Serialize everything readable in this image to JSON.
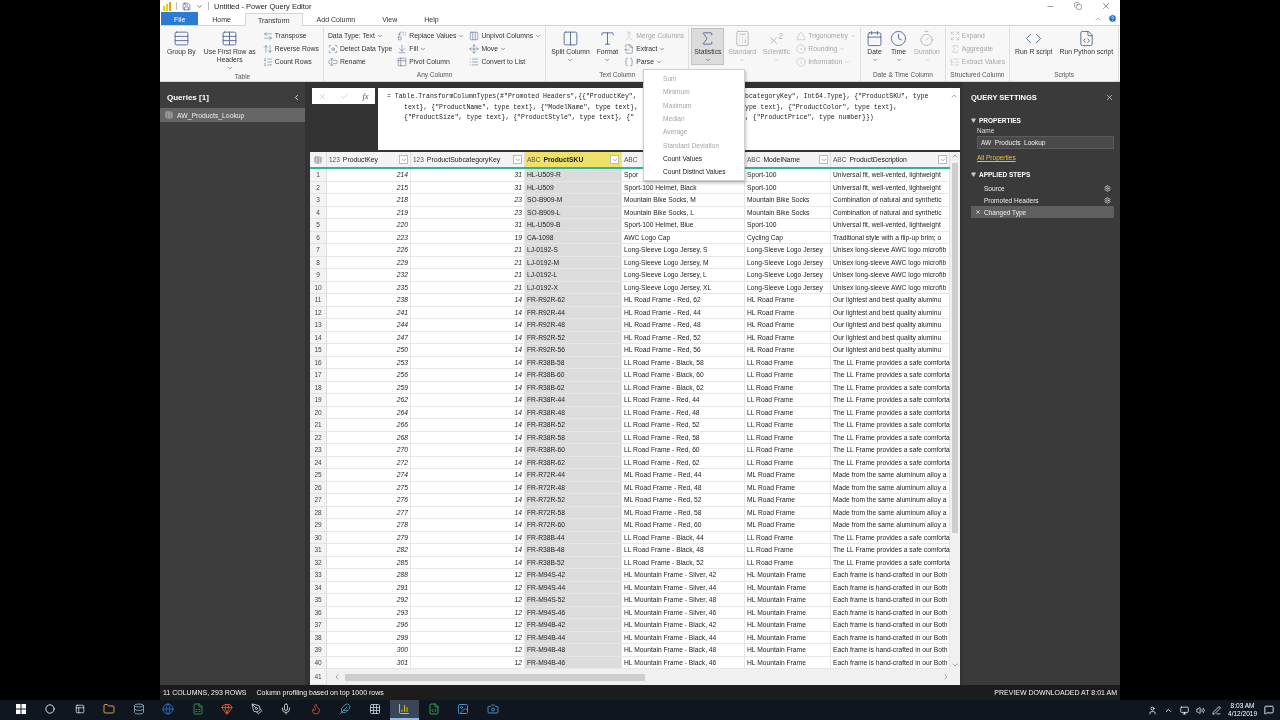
{
  "window": {
    "title": "Untitled - Power Query Editor"
  },
  "tabs": [
    {
      "label": "File",
      "kind": "file",
      "selected": false
    },
    {
      "label": "Home",
      "kind": "tab",
      "selected": false
    },
    {
      "label": "Transform",
      "kind": "tab",
      "selected": true
    },
    {
      "label": "Add Column",
      "kind": "tab",
      "selected": false
    },
    {
      "label": "View",
      "kind": "tab",
      "selected": false
    },
    {
      "label": "Help",
      "kind": "tab",
      "selected": false
    }
  ],
  "ribbon": [
    {
      "label": "Table",
      "columns": [
        {
          "kind": "large",
          "label": "Group By",
          "caret": false,
          "disabled": false,
          "pressed": false
        },
        {
          "kind": "large",
          "label": "Use First Row as Headers",
          "caret": true,
          "disabled": false,
          "pressed": false
        },
        {
          "kind": "stack",
          "items": [
            {
              "label": "Transpose",
              "caret": false,
              "disabled": false
            },
            {
              "label": "Reverse Rows",
              "caret": false,
              "disabled": false
            },
            {
              "label": "Count Rows",
              "caret": false,
              "disabled": false
            }
          ]
        }
      ]
    },
    {
      "label": "Any Column",
      "columns": [
        {
          "kind": "stack",
          "items": [
            {
              "label": "Data Type: Text",
              "caret": true,
              "disabled": false
            },
            {
              "label": "Detect Data Type",
              "caret": false,
              "disabled": false
            },
            {
              "label": "Rename",
              "caret": false,
              "disabled": false
            }
          ]
        },
        {
          "kind": "stack",
          "items": [
            {
              "label": "Replace Values",
              "caret": true,
              "disabled": false
            },
            {
              "label": "Fill",
              "caret": true,
              "disabled": false
            },
            {
              "label": "Pivot Column",
              "caret": false,
              "disabled": false
            }
          ]
        },
        {
          "kind": "stack",
          "items": [
            {
              "label": "Unpivot Columns",
              "caret": true,
              "disabled": false
            },
            {
              "label": "Move",
              "caret": true,
              "disabled": false
            },
            {
              "label": "Convert to List",
              "caret": false,
              "disabled": false
            }
          ]
        }
      ]
    },
    {
      "label": "Text Column",
      "columns": [
        {
          "kind": "large",
          "label": "Split Column",
          "caret": true,
          "disabled": false,
          "pressed": false
        },
        {
          "kind": "large",
          "label": "Format",
          "caret": true,
          "disabled": false,
          "pressed": false
        },
        {
          "kind": "stack",
          "items": [
            {
              "label": "Merge Columns",
              "caret": false,
              "disabled": true
            },
            {
              "label": "Extract",
              "caret": true,
              "disabled": false
            },
            {
              "label": "Parse",
              "caret": true,
              "disabled": false
            }
          ]
        }
      ]
    },
    {
      "columns": [
        {
          "kind": "large",
          "label": "Statistics",
          "caret": true,
          "disabled": false,
          "pressed": true
        },
        {
          "kind": "large",
          "label": "Standard",
          "caret": true,
          "disabled": true,
          "pressed": false
        },
        {
          "kind": "large",
          "label": "Scientific",
          "caret": true,
          "disabled": true,
          "pressed": false
        },
        {
          "kind": "stack",
          "items": [
            {
              "label": "Trigonometry",
              "caret": true,
              "disabled": true
            },
            {
              "label": "Rounding",
              "caret": true,
              "disabled": true
            },
            {
              "label": "Information",
              "caret": true,
              "disabled": true
            }
          ]
        }
      ]
    },
    {
      "label": "Date & Time Column",
      "columns": [
        {
          "kind": "large",
          "label": "Date",
          "caret": true,
          "disabled": false,
          "pressed": false
        },
        {
          "kind": "large",
          "label": "Time",
          "caret": true,
          "disabled": false,
          "pressed": false
        },
        {
          "kind": "large",
          "label": "Duration",
          "caret": true,
          "disabled": true,
          "pressed": false
        }
      ]
    },
    {
      "label": "Structured Column",
      "columns": [
        {
          "kind": "stack",
          "items": [
            {
              "label": "Expand",
              "caret": false,
              "disabled": true
            },
            {
              "label": "Aggregate",
              "caret": false,
              "disabled": true
            },
            {
              "label": "Extract Values",
              "caret": false,
              "disabled": true
            }
          ]
        }
      ]
    },
    {
      "label": "Scripts",
      "columns": [
        {
          "kind": "large",
          "label": "Run R script",
          "caret": false,
          "disabled": false,
          "pressed": false
        },
        {
          "kind": "large",
          "label": "Run Python script",
          "caret": false,
          "disabled": false,
          "pressed": false
        }
      ]
    }
  ],
  "statistics_menu": {
    "items": [
      {
        "label": "Sum",
        "disabled": true
      },
      {
        "label": "Minimum",
        "disabled": true
      },
      {
        "label": "Maximum",
        "disabled": true
      },
      {
        "label": "Median",
        "disabled": true
      },
      {
        "label": "Average",
        "disabled": true
      },
      {
        "label": "Standard Deviation",
        "disabled": true
      },
      {
        "label": "Count Values",
        "disabled": false
      },
      {
        "label": "Count Distinct Values",
        "disabled": false
      }
    ]
  },
  "queries_pane": {
    "title": "Queries [1]",
    "items": [
      {
        "label": "AW_Products_Lookup",
        "selected": true
      }
    ]
  },
  "formula_bar": {
    "fx": "fx",
    "lines": [
      {
        "left": "= Table.TransformColumnTypes(#\"Promoted Headers\",{{\"ProductKey\",",
        "right": "bcategoryKey\", Int64.Type}, {\"ProductSKU\", type"
      },
      {
        "left": "text}, {\"ProductName\", type text}, {\"ModelName\", type text},",
        "right": "ype text}, {\"ProductColor\", type text},"
      },
      {
        "left": "{\"ProductSize\", type text}, {\"ProductStyle\", type text}, {\"",
        "right": ", {\"ProductPrice\", type number}})"
      }
    ]
  },
  "grid": {
    "columns": [
      {
        "kind": "number",
        "badge": "123",
        "name": "ProductKey",
        "selected": false
      },
      {
        "kind": "number",
        "badge": "123",
        "name": "ProductSubcategoryKey",
        "selected": false
      },
      {
        "kind": "text",
        "badge": "ABC",
        "name": "ProductSKU",
        "selected": true
      },
      {
        "kind": "text",
        "badge": "ABC",
        "selected": false
      },
      {
        "kind": "text",
        "badge": "ABC",
        "name": "ModelName",
        "selected": false
      },
      {
        "kind": "text",
        "badge": "ABC",
        "name": "ProductDescription",
        "selected": false
      }
    ],
    "rows": [
      {
        "number": "1",
        "cells": [
          "214",
          "31",
          "HL-U509-R",
          "Spor",
          "Sport-100",
          "Universal fit, well-vented, lightweight"
        ]
      },
      {
        "number": "2",
        "cells": [
          "215",
          "31",
          "HL-U509",
          "Sport-100 Helmet, Black",
          "Sport-100",
          "Universal fit, well-vented, lightweight"
        ]
      },
      {
        "number": "3",
        "cells": [
          "218",
          "23",
          "SO-B909-M",
          "Mountain Bike Socks, M",
          "Mountain Bike Socks",
          "Combination of natural and synthetic"
        ]
      },
      {
        "number": "4",
        "cells": [
          "219",
          "23",
          "SO-B909-L",
          "Mountain Bike Socks, L",
          "Mountain Bike Socks",
          "Combination of natural and synthetic"
        ]
      },
      {
        "number": "5",
        "cells": [
          "220",
          "31",
          "HL-U509-B",
          "Sport-100 Helmet, Blue",
          "Sport-100",
          "Universal fit, well-vented, lightweight"
        ]
      },
      {
        "number": "6",
        "cells": [
          "223",
          "19",
          "CA-1098",
          "AWC Logo Cap",
          "Cycling Cap",
          "Traditional style with a flip-up brim; o"
        ]
      },
      {
        "number": "7",
        "cells": [
          "226",
          "21",
          "LJ-0192-S",
          "Long-Sleeve Logo Jersey, S",
          "Long-Sleeve Logo Jersey",
          "Unisex long-sleeve AWC logo microfib"
        ]
      },
      {
        "number": "8",
        "cells": [
          "229",
          "21",
          "LJ-0192-M",
          "Long-Sleeve Logo Jersey, M",
          "Long-Sleeve Logo Jersey",
          "Unisex long-sleeve AWC logo microfib"
        ]
      },
      {
        "number": "9",
        "cells": [
          "232",
          "21",
          "LJ-0192-L",
          "Long-Sleeve Logo Jersey, L",
          "Long-Sleeve Logo Jersey",
          "Unisex long-sleeve AWC logo microfib"
        ]
      },
      {
        "number": "10",
        "cells": [
          "235",
          "21",
          "LJ-0192-X",
          "Long-Sleeve Logo Jersey, XL",
          "Long-Sleeve Logo Jersey",
          "Unisex long-sleeve AWC logo microfib"
        ]
      },
      {
        "number": "11",
        "cells": [
          "238",
          "14",
          "FR-R92R-62",
          "HL Road Frame - Red, 62",
          "HL Road Frame",
          "Our lightest and best quality aluminu"
        ]
      },
      {
        "number": "12",
        "cells": [
          "241",
          "14",
          "FR-R92R-44",
          "HL Road Frame - Red, 44",
          "HL Road Frame",
          "Our lightest and best quality aluminu"
        ]
      },
      {
        "number": "13",
        "cells": [
          "244",
          "14",
          "FR-R92R-48",
          "HL Road Frame - Red, 48",
          "HL Road Frame",
          "Our lightest and best quality aluminu"
        ]
      },
      {
        "number": "14",
        "cells": [
          "247",
          "14",
          "FR-R92R-52",
          "HL Road Frame - Red, 52",
          "HL Road Frame",
          "Our lightest and best quality aluminu"
        ]
      },
      {
        "number": "15",
        "cells": [
          "250",
          "14",
          "FR-R92R-56",
          "HL Road Frame - Red, 56",
          "HL Road Frame",
          "Our lightest and best quality aluminu"
        ]
      },
      {
        "number": "16",
        "cells": [
          "253",
          "14",
          "FR-R38B-58",
          "LL Road Frame - Black, 58",
          "LL Road Frame",
          "The LL Frame provides a safe comforta"
        ]
      },
      {
        "number": "17",
        "cells": [
          "256",
          "14",
          "FR-R38B-60",
          "LL Road Frame - Black, 60",
          "LL Road Frame",
          "The LL Frame provides a safe comforta"
        ]
      },
      {
        "number": "18",
        "cells": [
          "259",
          "14",
          "FR-R38B-62",
          "LL Road Frame - Black, 62",
          "LL Road Frame",
          "The LL Frame provides a safe comforta"
        ]
      },
      {
        "number": "19",
        "cells": [
          "262",
          "14",
          "FR-R38R-44",
          "LL Road Frame - Red, 44",
          "LL Road Frame",
          "The LL Frame provides a safe comforta"
        ]
      },
      {
        "number": "20",
        "cells": [
          "264",
          "14",
          "FR-R38R-48",
          "LL Road Frame - Red, 48",
          "LL Road Frame",
          "The LL Frame provides a safe comforta"
        ]
      },
      {
        "number": "21",
        "cells": [
          "266",
          "14",
          "FR-R38R-52",
          "LL Road Frame - Red, 52",
          "LL Road Frame",
          "The LL Frame provides a safe comforta"
        ]
      },
      {
        "number": "22",
        "cells": [
          "268",
          "14",
          "FR-R38R-58",
          "LL Road Frame - Red, 58",
          "LL Road Frame",
          "The LL Frame provides a safe comforta"
        ]
      },
      {
        "number": "23",
        "cells": [
          "270",
          "14",
          "FR-R38R-60",
          "LL Road Frame - Red, 60",
          "LL Road Frame",
          "The LL Frame provides a safe comforta"
        ]
      },
      {
        "number": "24",
        "cells": [
          "272",
          "14",
          "FR-R38R-62",
          "LL Road Frame - Red, 62",
          "LL Road Frame",
          "The LL Frame provides a safe comforta"
        ]
      },
      {
        "number": "25",
        "cells": [
          "274",
          "14",
          "FR-R72R-44",
          "ML Road Frame - Red, 44",
          "ML Road Frame",
          "Made from the same aluminum alloy a"
        ]
      },
      {
        "number": "26",
        "cells": [
          "275",
          "14",
          "FR-R72R-48",
          "ML Road Frame - Red, 48",
          "ML Road Frame",
          "Made from the same aluminum alloy a"
        ]
      },
      {
        "number": "27",
        "cells": [
          "276",
          "14",
          "FR-R72R-52",
          "ML Road Frame - Red, 52",
          "ML Road Frame",
          "Made from the same aluminum alloy a"
        ]
      },
      {
        "number": "28",
        "cells": [
          "277",
          "14",
          "FR-R72R-58",
          "ML Road Frame - Red, 58",
          "ML Road Frame",
          "Made from the same aluminum alloy a"
        ]
      },
      {
        "number": "29",
        "cells": [
          "278",
          "14",
          "FR-R72R-60",
          "ML Road Frame - Red, 60",
          "ML Road Frame",
          "Made from the same aluminum alloy a"
        ]
      },
      {
        "number": "30",
        "cells": [
          "279",
          "14",
          "FR-R38B-44",
          "LL Road Frame - Black, 44",
          "LL Road Frame",
          "The LL Frame provides a safe comforta"
        ]
      },
      {
        "number": "31",
        "cells": [
          "282",
          "14",
          "FR-R38B-48",
          "LL Road Frame - Black, 48",
          "LL Road Frame",
          "The LL Frame provides a safe comforta"
        ]
      },
      {
        "number": "32",
        "cells": [
          "285",
          "14",
          "FR-R38B-52",
          "LL Road Frame - Black, 52",
          "LL Road Frame",
          "The LL Frame provides a safe comforta"
        ]
      },
      {
        "number": "33",
        "cells": [
          "288",
          "12",
          "FR-M94S-42",
          "HL Mountain Frame - Silver, 42",
          "HL Mountain Frame",
          "Each frame is hand-crafted in our Both"
        ]
      },
      {
        "number": "34",
        "cells": [
          "291",
          "12",
          "FR-M94S-44",
          "HL Mountain Frame - Silver, 44",
          "HL Mountain Frame",
          "Each frame is hand-crafted in our Both"
        ]
      },
      {
        "number": "35",
        "cells": [
          "292",
          "12",
          "FR-M94S-52",
          "HL Mountain Frame - Silver, 48",
          "HL Mountain Frame",
          "Each frame is hand-crafted in our Both"
        ]
      },
      {
        "number": "36",
        "cells": [
          "293",
          "12",
          "FR-M94S-46",
          "HL Mountain Frame - Silver, 46",
          "HL Mountain Frame",
          "Each frame is hand-crafted in our Both"
        ]
      },
      {
        "number": "37",
        "cells": [
          "296",
          "12",
          "FR-M94B-42",
          "HL Mountain Frame - Black, 42",
          "HL Mountain Frame",
          "Each frame is hand-crafted in our Both"
        ]
      },
      {
        "number": "38",
        "cells": [
          "299",
          "12",
          "FR-M94B-44",
          "HL Mountain Frame - Black, 44",
          "HL Mountain Frame",
          "Each frame is hand-crafted in our Both"
        ]
      },
      {
        "number": "39",
        "cells": [
          "300",
          "12",
          "FR-M94B-48",
          "HL Mountain Frame - Black, 48",
          "HL Mountain Frame",
          "Each frame is hand-crafted in our Both"
        ]
      },
      {
        "number": "40",
        "cells": [
          "301",
          "12",
          "FR-M94B-46",
          "HL Mountain Frame - Black, 46",
          "HL Mountain Frame",
          "Each frame is hand-crafted in our Both"
        ]
      }
    ],
    "partial_row_number": "41"
  },
  "query_settings": {
    "title": "QUERY SETTINGS",
    "properties_heading": "PROPERTIES",
    "name_label": "Name",
    "name_value": "AW_Products_Lookup",
    "all_properties_link": "All Properties",
    "steps_heading": "APPLIED STEPS",
    "steps": [
      {
        "label": "Source",
        "selected": false,
        "has_settings": true
      },
      {
        "label": "Promoted Headers",
        "selected": false,
        "has_settings": true
      },
      {
        "label": "Changed Type",
        "selected": true,
        "has_settings": false
      }
    ]
  },
  "status_bar": {
    "left": "11 COLUMNS, 293 ROWS",
    "profiling": "Column profiling based on top 1000 rows",
    "right": "PREVIEW DOWNLOADED AT 8:01 AM"
  },
  "taskbar": {
    "apps": [
      {
        "selected": false
      },
      {
        "selected": false
      },
      {
        "selected": false
      },
      {
        "selected": false
      },
      {
        "selected": false
      },
      {
        "selected": false
      },
      {
        "selected": false
      },
      {
        "selected": false
      },
      {
        "selected": false
      },
      {
        "selected": false
      },
      {
        "selected": true
      },
      {
        "selected": false
      },
      {
        "selected": false
      },
      {
        "selected": false
      }
    ],
    "time": "8:03 AM",
    "date": "4/12/2019"
  }
}
